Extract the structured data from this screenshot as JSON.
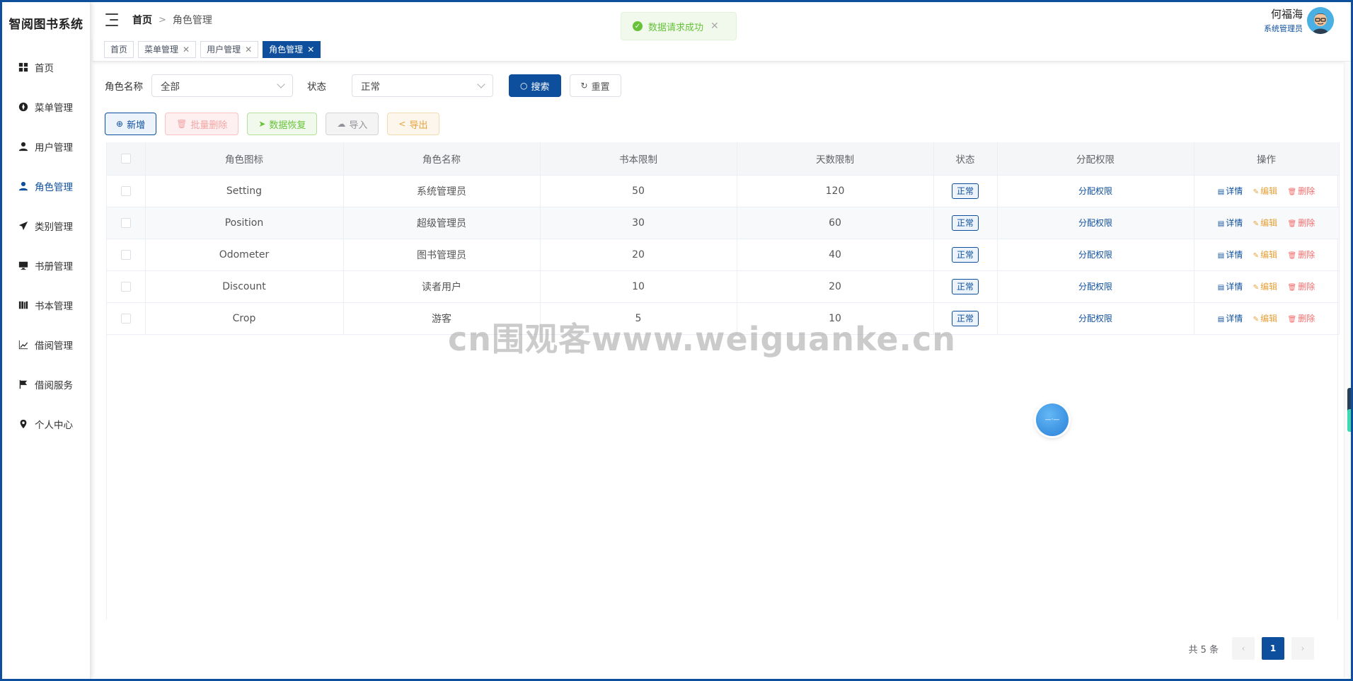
{
  "app_title": "智阅图书系统",
  "sidebar": {
    "items": [
      {
        "label": "首页",
        "icon": "dashboard-icon"
      },
      {
        "label": "菜单管理",
        "icon": "compass-icon"
      },
      {
        "label": "用户管理",
        "icon": "user-icon"
      },
      {
        "label": "角色管理",
        "icon": "user-icon",
        "active": true
      },
      {
        "label": "类别管理",
        "icon": "paper-plane-icon"
      },
      {
        "label": "书册管理",
        "icon": "monitor-icon"
      },
      {
        "label": "书本管理",
        "icon": "books-icon"
      },
      {
        "label": "借阅管理",
        "icon": "chart-icon"
      },
      {
        "label": "借阅服务",
        "icon": "flag-icon"
      },
      {
        "label": "个人中心",
        "icon": "location-icon"
      }
    ]
  },
  "header": {
    "breadcrumb_home": "首页",
    "breadcrumb_sep": ">",
    "breadcrumb_current": "角色管理",
    "user_name": "何福海",
    "user_role": "系统管理员"
  },
  "toast": {
    "text": "数据请求成功",
    "close": "✕"
  },
  "tabs": [
    {
      "label": "首页",
      "closable": false
    },
    {
      "label": "菜单管理",
      "closable": true
    },
    {
      "label": "用户管理",
      "closable": true
    },
    {
      "label": "角色管理",
      "closable": true,
      "active": true
    }
  ],
  "filter": {
    "role_label": "角色名称",
    "role_value": "全部",
    "status_label": "状态",
    "status_value": "正常",
    "search_btn": "搜索",
    "reset_btn": "重置"
  },
  "actions": {
    "add": "新增",
    "batch_delete": "批量删除",
    "restore": "数据恢复",
    "import": "导入",
    "export": "导出"
  },
  "table": {
    "columns": [
      "角色图标",
      "角色名称",
      "书本限制",
      "天数限制",
      "状态",
      "分配权限",
      "操作"
    ],
    "rows": [
      {
        "icon": "Setting",
        "name": "系统管理员",
        "book_limit": "50",
        "day_limit": "120",
        "status": "正常",
        "perm": "分配权限"
      },
      {
        "icon": "Position",
        "name": "超级管理员",
        "book_limit": "30",
        "day_limit": "60",
        "status": "正常",
        "perm": "分配权限"
      },
      {
        "icon": "Odometer",
        "name": "图书管理员",
        "book_limit": "20",
        "day_limit": "40",
        "status": "正常",
        "perm": "分配权限"
      },
      {
        "icon": "Discount",
        "name": "读者用户",
        "book_limit": "10",
        "day_limit": "20",
        "status": "正常",
        "perm": "分配权限"
      },
      {
        "icon": "Crop",
        "name": "游客",
        "book_limit": "5",
        "day_limit": "10",
        "status": "正常",
        "perm": "分配权限"
      }
    ],
    "op_detail": "详情",
    "op_edit": "编辑",
    "op_delete": "删除"
  },
  "pagination": {
    "total": "共 5 条",
    "current": "1",
    "prev": "‹",
    "next": "›"
  },
  "watermark": "cn围观客www.weiguanke.cn",
  "colors": {
    "primary": "#0d4f9c",
    "success": "#67c23a",
    "warning": "#e6a23c",
    "danger": "#f56c6c"
  }
}
